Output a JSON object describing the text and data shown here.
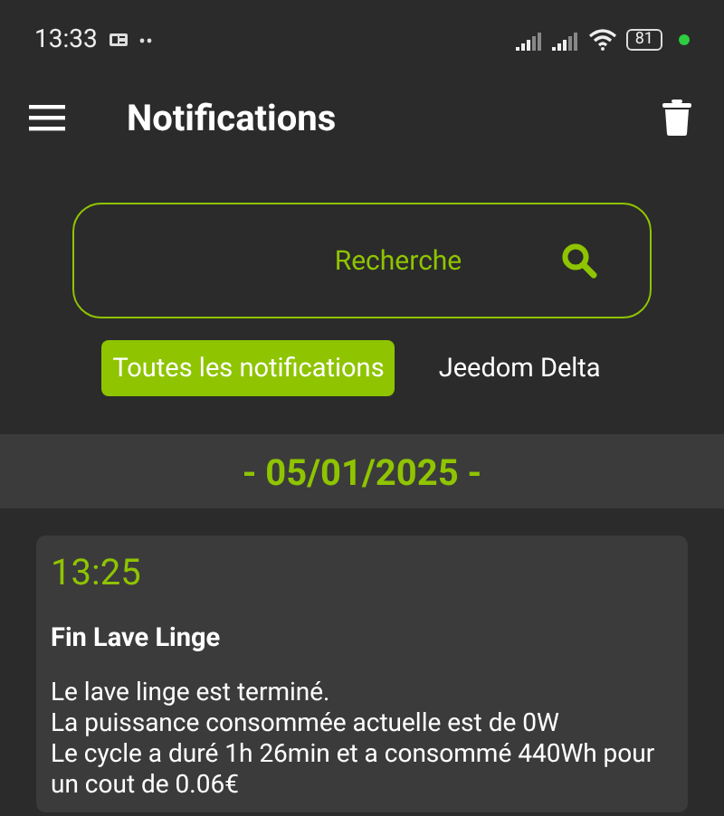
{
  "status_bar": {
    "time": "13:33",
    "battery": "81"
  },
  "app_bar": {
    "title": "Notifications"
  },
  "search": {
    "placeholder": "Recherche"
  },
  "filters": [
    {
      "label": "Toutes les notifications",
      "selected": true
    },
    {
      "label": "Jeedom Delta",
      "selected": false
    }
  ],
  "groups": [
    {
      "date": "- 05/01/2025 -",
      "notifications": [
        {
          "time": "13:25",
          "title": "Fin Lave Linge",
          "message": "Le lave linge est terminé.\nLa puissance consommée actuelle est de 0W\nLe cycle a duré 1h 26min et a consommé 440Wh pour un cout de 0.06€"
        }
      ]
    }
  ]
}
